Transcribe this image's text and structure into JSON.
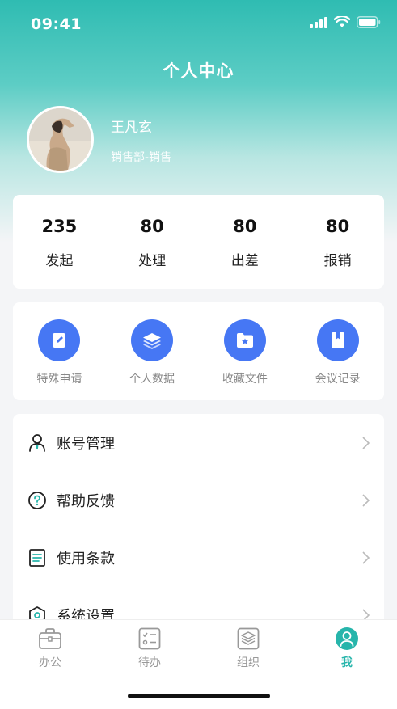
{
  "status_bar": {
    "time": "09:41"
  },
  "header": {
    "title": "个人中心"
  },
  "user": {
    "name": "王凡玄",
    "department": "销售部-销售"
  },
  "stats": [
    {
      "value": "235",
      "label": "发起"
    },
    {
      "value": "80",
      "label": "处理"
    },
    {
      "value": "80",
      "label": "出差"
    },
    {
      "value": "80",
      "label": "报销"
    }
  ],
  "quick_actions": [
    {
      "label": "特殊申请",
      "icon": "edit-icon"
    },
    {
      "label": "个人数据",
      "icon": "layers-icon"
    },
    {
      "label": "收藏文件",
      "icon": "folder-star-icon"
    },
    {
      "label": "会议记录",
      "icon": "book-icon"
    }
  ],
  "menu": [
    {
      "label": "账号管理",
      "icon": "user-icon"
    },
    {
      "label": "帮助反馈",
      "icon": "help-icon"
    },
    {
      "label": "使用条款",
      "icon": "document-icon"
    },
    {
      "label": "系统设置",
      "icon": "settings-icon"
    }
  ],
  "tabs": [
    {
      "label": "办公",
      "icon": "briefcase-icon",
      "active": false
    },
    {
      "label": "待办",
      "icon": "checklist-icon",
      "active": false
    },
    {
      "label": "组织",
      "icon": "stack-icon",
      "active": false
    },
    {
      "label": "我",
      "icon": "profile-icon",
      "active": true
    }
  ],
  "colors": {
    "accent": "#27b5ab",
    "primary_blue": "#4677f4",
    "header_teal": "#2fbcb2"
  }
}
